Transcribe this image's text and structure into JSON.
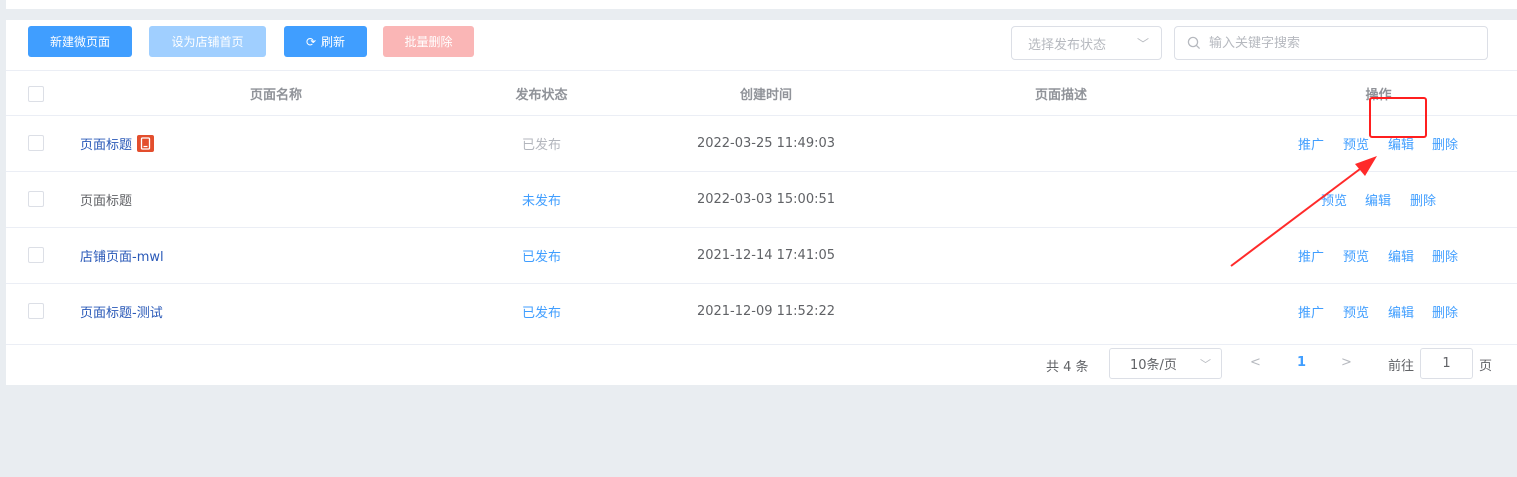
{
  "toolbar": {
    "new_label": "新建微页面",
    "set_home_label": "设为店铺首页",
    "refresh_label": "刷新",
    "batch_delete_label": "批量删除",
    "status_select_placeholder": "选择发布状态",
    "search_placeholder": "输入关键字搜索"
  },
  "table": {
    "headers": {
      "name": "页面名称",
      "status": "发布状态",
      "created": "创建时间",
      "desc": "页面描述",
      "ops": "操作"
    },
    "rows": [
      {
        "name": "页面标题",
        "status": "已发布",
        "created": "2022-03-25 11:49:03",
        "desc": "",
        "ops": [
          "推广",
          "预览",
          "编辑",
          "删除"
        ]
      },
      {
        "name": "页面标题",
        "status": "未发布",
        "created": "2022-03-03 15:00:51",
        "desc": "",
        "ops": [
          "预览",
          "编辑",
          "删除"
        ]
      },
      {
        "name": "店铺页面-mwl",
        "status": "已发布",
        "created": "2021-12-14 17:41:05",
        "desc": "",
        "ops": [
          "推广",
          "预览",
          "编辑",
          "删除"
        ]
      },
      {
        "name": "页面标题-测试",
        "status": "已发布",
        "created": "2021-12-09 11:52:22",
        "desc": "",
        "ops": [
          "推广",
          "预览",
          "编辑",
          "删除"
        ]
      }
    ]
  },
  "pagination": {
    "total": "共 4 条",
    "page_size": "10条/页",
    "current_page": "1",
    "goto_label": "前往",
    "goto_value": "1",
    "goto_unit": "页"
  },
  "colors": {
    "primary": "#409eff",
    "danger_light": "#fab6b6",
    "annotation": "#ff1f1f"
  },
  "icons": [
    "refresh-icon",
    "search-icon",
    "chevron-down-icon",
    "mobile-page-icon",
    "annotation-arrow"
  ]
}
